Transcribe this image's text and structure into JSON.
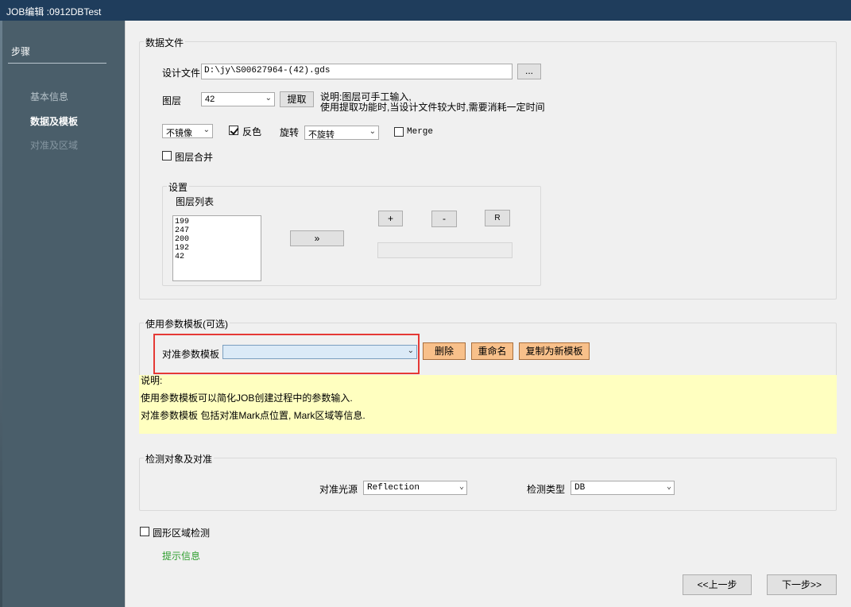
{
  "window": {
    "title": "JOB编辑 :0912DBTest"
  },
  "sidebar": {
    "header": "步骤",
    "items": [
      {
        "label": "基本信息",
        "state": "dim"
      },
      {
        "label": "数据及模板",
        "state": "active"
      },
      {
        "label": "对准及区域",
        "state": "faint"
      }
    ]
  },
  "data_file": {
    "group_label": "数据文件",
    "design_file_label": "设计文件",
    "design_file_value": "D:\\jy\\S00627964-(42).gds",
    "browse_label": "...",
    "layer_label": "图层",
    "layer_value": "42",
    "extract_label": "提取",
    "note_line1": "说明:图层可手工输入,",
    "note_line2": "使用提取功能时,当设计文件较大时,需要消耗一定时间",
    "mirror_value": "不镜像",
    "invert_label": "反色",
    "invert_checked": true,
    "rotate_label": "旋转",
    "rotate_value": "不旋转",
    "merge_label": "Merge",
    "merge_checked": false,
    "layer_merge_label": "图层合并",
    "layer_merge_checked": false,
    "settings": {
      "group_label": "设置",
      "list_label": "图层列表",
      "layers": [
        "199",
        "247",
        "200",
        "192",
        "42"
      ],
      "move_button": "»",
      "plus_button": "+",
      "minus_button": "-",
      "r_button": "R"
    }
  },
  "template": {
    "group_label": "使用参数模板(可选)",
    "align_template_label": "对准参数模板",
    "align_template_value": "",
    "delete_label": "删除",
    "rename_label": "重命名",
    "copy_label": "复制为新模板",
    "note_title": "说明:",
    "note_line1": "使用参数模板可以简化JOB创建过程中的参数输入.",
    "note_line2": "对准参数模板  包括对准Mark点位置, Mark区域等信息."
  },
  "inspection": {
    "group_label": "检测对象及对准",
    "light_label": "对准光源",
    "light_value": "Reflection",
    "type_label": "检测类型",
    "type_value": "DB"
  },
  "circular": {
    "label": "圆形区域检测",
    "checked": false
  },
  "hint": {
    "text": "提示信息",
    "color": "#2e9e2e"
  },
  "nav": {
    "prev_label": "<<上一步",
    "next_label": "下一步>>"
  },
  "colors": {
    "highlight_border": "#e53935",
    "note_background": "#ffffc0",
    "action_button": "#f8c08a"
  }
}
